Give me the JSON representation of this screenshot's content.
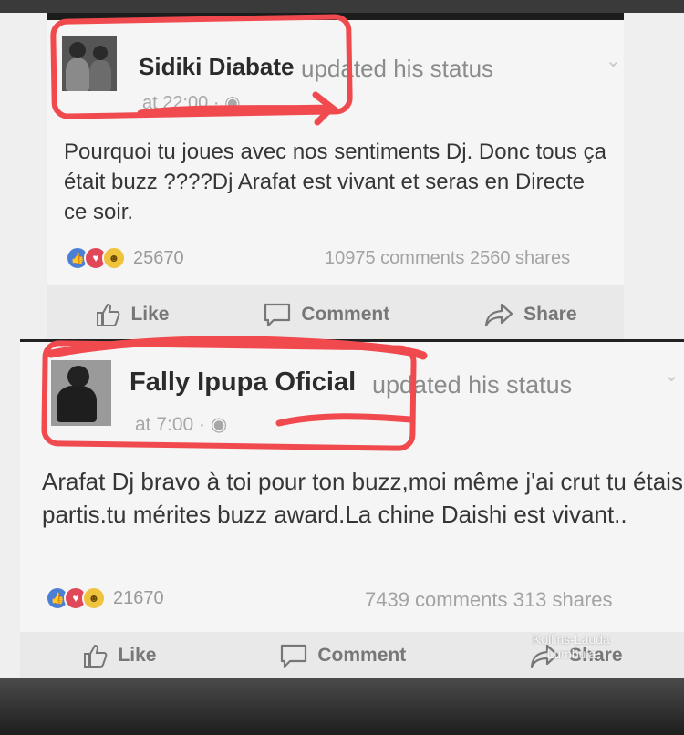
{
  "posts": [
    {
      "author": "Sidiki Diabate",
      "action": "updated his status",
      "time": "at 22:00 ·",
      "text": "Pourquoi tu joues avec nos sentiments Dj. Donc tous ça était buzz ????Dj Arafat est vivant et seras en Directe ce soir.",
      "reaction_count": "25670",
      "comments": "10975 comments",
      "shares": "2560 shares"
    },
    {
      "author": "Fally Ipupa Oficial",
      "action": "updated his status",
      "time": "at 7:00 ·",
      "text": "Arafat Dj bravo à toi pour ton buzz,moi même j'ai crut tu étais partis.tu mérites buzz award.La chine Daishi est vivant..",
      "reaction_count": "21670",
      "comments": "7439 comments",
      "shares": "313 shares"
    }
  ],
  "actions": {
    "like": "Like",
    "comment": "Comment",
    "share": "Share"
  },
  "watermark": {
    "line1": "Kollins-Lauda",
    "line2": "Lumbula"
  },
  "colors": {
    "highlight": "#f04a4f",
    "like": "#4b7fd6",
    "love": "#e0485a",
    "wow": "#f0c33c"
  },
  "icons": [
    "globe-icon",
    "like-reaction-icon",
    "love-reaction-icon",
    "wow-reaction-icon",
    "thumbs-up-icon",
    "comment-bubble-icon",
    "share-arrow-icon",
    "chevron-down-icon"
  ]
}
